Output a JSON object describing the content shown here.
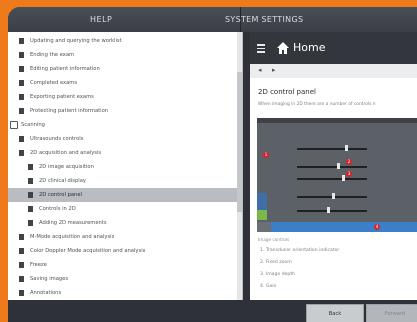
{
  "topbar": {
    "help_label": "HELP",
    "system_label": "SYSTEM SETTINGS"
  },
  "tree": {
    "items": [
      {
        "label": "Updating and querying the worklist",
        "indent": 0
      },
      {
        "label": "Ending the exam",
        "indent": 0
      },
      {
        "label": "Editing patient information",
        "indent": 0
      },
      {
        "label": "Completed exams",
        "indent": 0
      },
      {
        "label": "Exporting patient exams",
        "indent": 0
      },
      {
        "label": "Protecting patient information",
        "indent": 0
      },
      {
        "label": "Scanning",
        "indent": -1
      },
      {
        "label": "Ultrasounds controls",
        "indent": 0
      },
      {
        "label": "2D acquisition and analysis",
        "indent": 0
      },
      {
        "label": "2D image acquisition",
        "indent": 1
      },
      {
        "label": "2D clinical display",
        "indent": 1
      },
      {
        "label": "2D control panel",
        "indent": 1
      },
      {
        "label": "Controls in 2D",
        "indent": 1
      },
      {
        "label": "Adding 2D measurements",
        "indent": 1
      },
      {
        "label": "M-Mode acquisition and analysis",
        "indent": 0
      },
      {
        "label": "Color Doppler Mode acquisition and analysis",
        "indent": 0
      },
      {
        "label": "Freeze",
        "indent": 0
      },
      {
        "label": "Saving images",
        "indent": 0
      },
      {
        "label": "Annotations",
        "indent": 0
      }
    ],
    "selected": "2D control panel"
  },
  "content": {
    "header_title": "Home",
    "page_title": "2D control panel",
    "description": "When imaging in 2D there are a number of controls n",
    "image_caption": "Image controls",
    "list_items": [
      "1.  Transducer orientation indicator",
      "2.  Fixed zoom",
      "3.  Image depth",
      "4.  Gain"
    ]
  },
  "buttons": {
    "back_label": "Back",
    "forward_label": "Forward"
  },
  "colors": {
    "accent_orange": "#ef7a1b",
    "selection_gray": "#b9bcc0",
    "header_dark": "#33373d"
  }
}
